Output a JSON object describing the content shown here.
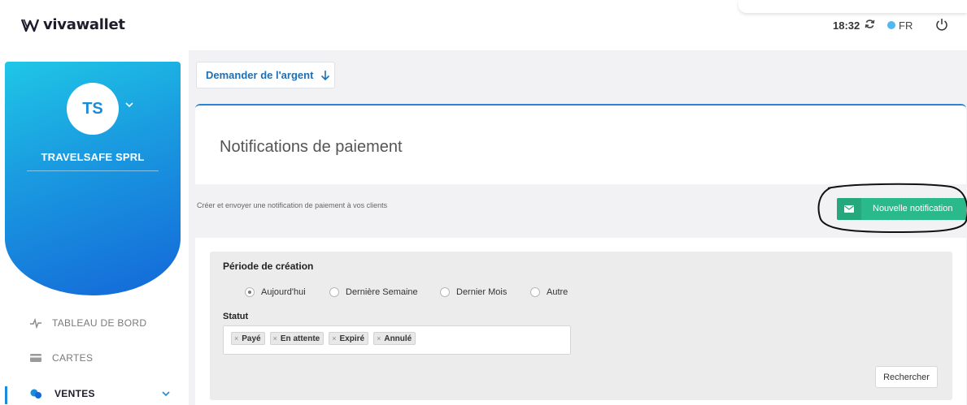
{
  "header": {
    "logo_text": "vivawallet",
    "time": "18:32",
    "language": "FR"
  },
  "sidebar": {
    "avatar_initials": "TS",
    "company_name": "TRAVELSAFE SPRL",
    "items": [
      {
        "label": "TABLEAU DE BORD",
        "icon": "pulse-icon"
      },
      {
        "label": "CARTES",
        "icon": "card-icon"
      },
      {
        "label": "VENTES",
        "icon": "sales-icon",
        "active": true
      }
    ]
  },
  "main": {
    "request_button": "Demander de l'argent",
    "page_title": "Notifications de paiement",
    "subtitle": "Créer et envoyer une notification de paiement à vos clients",
    "new_notification_button": "Nouvelle notification",
    "filters": {
      "period_label": "Période de création",
      "period_options": [
        "Aujourd'hui",
        "Dernière Semaine",
        "Dernier Mois",
        "Autre"
      ],
      "period_selected": "Aujourd'hui",
      "status_label": "Statut",
      "status_tags": [
        "Payé",
        "En attente",
        "Expiré",
        "Annulé"
      ],
      "search_button": "Rechercher"
    }
  },
  "colors": {
    "accent_blue": "#1a8cd8",
    "green_button": "#2ab98a",
    "title_border": "#2b84d8"
  }
}
